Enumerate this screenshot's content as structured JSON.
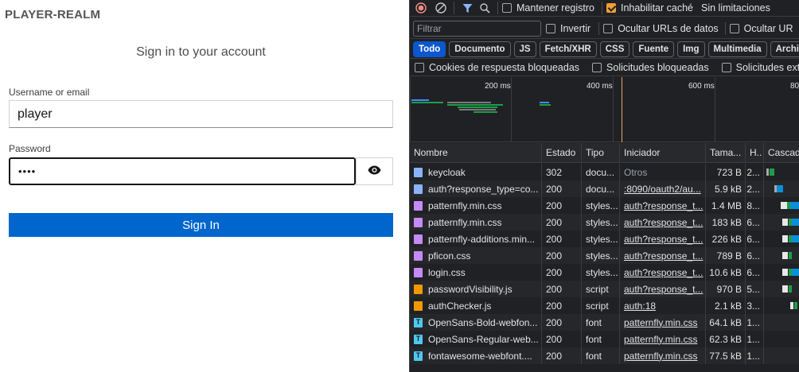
{
  "login": {
    "realm": "PLAYER-REALM",
    "title": "Sign in to your account",
    "username_label": "Username or email",
    "username_value": "player",
    "password_label": "Password",
    "password_value": "••••",
    "signin_button": "Sign In",
    "colors": {
      "primary": "#0066cc"
    }
  },
  "devtools": {
    "toolbar": {
      "preserve_log": "Mantener registro",
      "disable_cache": "Inhabilitar caché",
      "throttling": "Sin limitaciones"
    },
    "filter_row": {
      "placeholder": "Filtrar",
      "invert": "Invertir",
      "hide_data_urls": "Ocultar URLs de datos",
      "hide_ext": "Ocultar UR"
    },
    "type_filters": [
      "Todo",
      "Documento",
      "JS",
      "Fetch/XHR",
      "CSS",
      "Fuente",
      "Img",
      "Multimedia",
      "Archivo de ma"
    ],
    "blocked_row": {
      "blocked_cookies": "Cookies de respuesta bloqueadas",
      "blocked_requests": "Solicitudes bloqueadas",
      "third_party": "Solicitudes externa"
    },
    "overview_ticks": [
      "200 ms",
      "400 ms",
      "600 ms",
      "80"
    ],
    "columns": {
      "name": "Nombre",
      "status": "Estado",
      "type": "Tipo",
      "initiator": "Iniciador",
      "size": "Tama...",
      "time": "H..",
      "waterfall": "Cascada"
    },
    "requests": [
      {
        "name": "keycloak",
        "status": "302",
        "type": "docu...",
        "initiator": "Otros",
        "size": "723 B",
        "time": "2...",
        "icon": "doc"
      },
      {
        "name": "auth?response_type=co...",
        "status": "200",
        "type": "docu...",
        "initiator": ":8090/oauth2/au...",
        "size": "5.9 kB",
        "time": "2...",
        "icon": "doc"
      },
      {
        "name": "patternfly.min.css",
        "status": "200",
        "type": "styles...",
        "initiator": "auth?response_t...",
        "size": "1.4 MB",
        "time": "8...",
        "icon": "css"
      },
      {
        "name": "patternfly.min.css",
        "status": "200",
        "type": "styles...",
        "initiator": "auth?response_t...",
        "size": "183 kB",
        "time": "6...",
        "icon": "css"
      },
      {
        "name": "patternfly-additions.min...",
        "status": "200",
        "type": "styles...",
        "initiator": "auth?response_t...",
        "size": "226 kB",
        "time": "6...",
        "icon": "css"
      },
      {
        "name": "pficon.css",
        "status": "200",
        "type": "styles...",
        "initiator": "auth?response_t...",
        "size": "789 B",
        "time": "6...",
        "icon": "css"
      },
      {
        "name": "login.css",
        "status": "200",
        "type": "styles...",
        "initiator": "auth?response_t...",
        "size": "10.6 kB",
        "time": "6...",
        "icon": "css"
      },
      {
        "name": "passwordVisibility.js",
        "status": "200",
        "type": "script",
        "initiator": "auth?response_t...",
        "size": "970 B",
        "time": "5...",
        "icon": "script"
      },
      {
        "name": "authChecker.js",
        "status": "200",
        "type": "script",
        "initiator": "auth:18",
        "size": "2.1 kB",
        "time": "3...",
        "icon": "script"
      },
      {
        "name": "OpenSans-Bold-webfon...",
        "status": "200",
        "type": "font",
        "initiator": "patternfly.min.css",
        "size": "64.1 kB",
        "time": "1...",
        "icon": "font"
      },
      {
        "name": "OpenSans-Regular-web...",
        "status": "200",
        "type": "font",
        "initiator": "patternfly.min.css",
        "size": "62.3 kB",
        "time": "1...",
        "icon": "font"
      },
      {
        "name": "fontawesome-webfont....",
        "status": "200",
        "type": "font",
        "initiator": "patternfly.min.css",
        "size": "77.5 kB",
        "time": "1...",
        "icon": "font"
      }
    ]
  }
}
